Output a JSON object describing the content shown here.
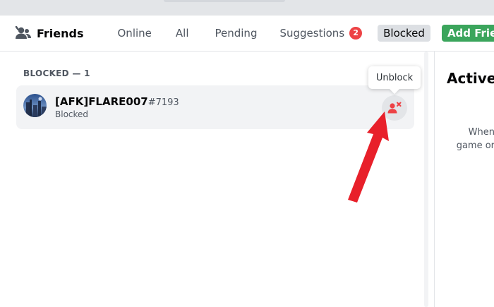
{
  "header": {
    "title": "Friends",
    "tabs": [
      {
        "label": "Online"
      },
      {
        "label": "All"
      },
      {
        "label": "Pending"
      },
      {
        "label": "Suggestions",
        "badge": "2"
      },
      {
        "label": "Blocked",
        "selected": true
      }
    ],
    "add_friend_label": "Add Friend"
  },
  "blocked": {
    "heading": "BLOCKED — 1",
    "users": [
      {
        "username": "[AFK]FLARE007",
        "discriminator": "#7193",
        "status": "Blocked"
      }
    ]
  },
  "tooltip": {
    "text": "Unblock"
  },
  "side_panel": {
    "title": "Active",
    "line1": "When",
    "line2": "game or"
  },
  "colors": {
    "accent_green": "#3ba55c",
    "badge_red": "#ed4245",
    "annotation_arrow": "#e8202a",
    "unblock_icon": "#ed4245"
  },
  "icons": {
    "friends": "friends-icon",
    "unblock": "unblock-user-icon"
  }
}
